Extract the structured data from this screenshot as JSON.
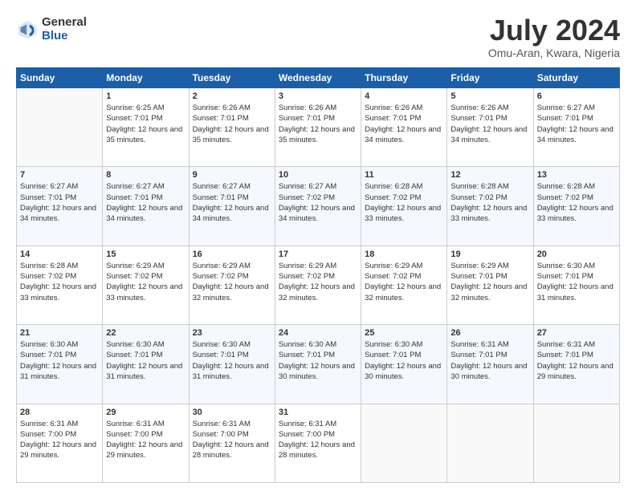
{
  "header": {
    "logo": {
      "general": "General",
      "blue": "Blue"
    },
    "title": "July 2024",
    "location": "Omu-Aran, Kwara, Nigeria"
  },
  "weekdays": [
    "Sunday",
    "Monday",
    "Tuesday",
    "Wednesday",
    "Thursday",
    "Friday",
    "Saturday"
  ],
  "weeks": [
    [
      {
        "day": "",
        "info": ""
      },
      {
        "day": "1",
        "sunrise": "6:25 AM",
        "sunset": "7:01 PM",
        "daylight": "12 hours and 35 minutes."
      },
      {
        "day": "2",
        "sunrise": "6:26 AM",
        "sunset": "7:01 PM",
        "daylight": "12 hours and 35 minutes."
      },
      {
        "day": "3",
        "sunrise": "6:26 AM",
        "sunset": "7:01 PM",
        "daylight": "12 hours and 35 minutes."
      },
      {
        "day": "4",
        "sunrise": "6:26 AM",
        "sunset": "7:01 PM",
        "daylight": "12 hours and 34 minutes."
      },
      {
        "day": "5",
        "sunrise": "6:26 AM",
        "sunset": "7:01 PM",
        "daylight": "12 hours and 34 minutes."
      },
      {
        "day": "6",
        "sunrise": "6:27 AM",
        "sunset": "7:01 PM",
        "daylight": "12 hours and 34 minutes."
      }
    ],
    [
      {
        "day": "7",
        "sunrise": "6:27 AM",
        "sunset": "7:01 PM",
        "daylight": "12 hours and 34 minutes."
      },
      {
        "day": "8",
        "sunrise": "6:27 AM",
        "sunset": "7:01 PM",
        "daylight": "12 hours and 34 minutes."
      },
      {
        "day": "9",
        "sunrise": "6:27 AM",
        "sunset": "7:01 PM",
        "daylight": "12 hours and 34 minutes."
      },
      {
        "day": "10",
        "sunrise": "6:27 AM",
        "sunset": "7:02 PM",
        "daylight": "12 hours and 34 minutes."
      },
      {
        "day": "11",
        "sunrise": "6:28 AM",
        "sunset": "7:02 PM",
        "daylight": "12 hours and 33 minutes."
      },
      {
        "day": "12",
        "sunrise": "6:28 AM",
        "sunset": "7:02 PM",
        "daylight": "12 hours and 33 minutes."
      },
      {
        "day": "13",
        "sunrise": "6:28 AM",
        "sunset": "7:02 PM",
        "daylight": "12 hours and 33 minutes."
      }
    ],
    [
      {
        "day": "14",
        "sunrise": "6:28 AM",
        "sunset": "7:02 PM",
        "daylight": "12 hours and 33 minutes."
      },
      {
        "day": "15",
        "sunrise": "6:29 AM",
        "sunset": "7:02 PM",
        "daylight": "12 hours and 33 minutes."
      },
      {
        "day": "16",
        "sunrise": "6:29 AM",
        "sunset": "7:02 PM",
        "daylight": "12 hours and 32 minutes."
      },
      {
        "day": "17",
        "sunrise": "6:29 AM",
        "sunset": "7:02 PM",
        "daylight": "12 hours and 32 minutes."
      },
      {
        "day": "18",
        "sunrise": "6:29 AM",
        "sunset": "7:02 PM",
        "daylight": "12 hours and 32 minutes."
      },
      {
        "day": "19",
        "sunrise": "6:29 AM",
        "sunset": "7:01 PM",
        "daylight": "12 hours and 32 minutes."
      },
      {
        "day": "20",
        "sunrise": "6:30 AM",
        "sunset": "7:01 PM",
        "daylight": "12 hours and 31 minutes."
      }
    ],
    [
      {
        "day": "21",
        "sunrise": "6:30 AM",
        "sunset": "7:01 PM",
        "daylight": "12 hours and 31 minutes."
      },
      {
        "day": "22",
        "sunrise": "6:30 AM",
        "sunset": "7:01 PM",
        "daylight": "12 hours and 31 minutes."
      },
      {
        "day": "23",
        "sunrise": "6:30 AM",
        "sunset": "7:01 PM",
        "daylight": "12 hours and 31 minutes."
      },
      {
        "day": "24",
        "sunrise": "6:30 AM",
        "sunset": "7:01 PM",
        "daylight": "12 hours and 30 minutes."
      },
      {
        "day": "25",
        "sunrise": "6:30 AM",
        "sunset": "7:01 PM",
        "daylight": "12 hours and 30 minutes."
      },
      {
        "day": "26",
        "sunrise": "6:31 AM",
        "sunset": "7:01 PM",
        "daylight": "12 hours and 30 minutes."
      },
      {
        "day": "27",
        "sunrise": "6:31 AM",
        "sunset": "7:01 PM",
        "daylight": "12 hours and 29 minutes."
      }
    ],
    [
      {
        "day": "28",
        "sunrise": "6:31 AM",
        "sunset": "7:00 PM",
        "daylight": "12 hours and 29 minutes."
      },
      {
        "day": "29",
        "sunrise": "6:31 AM",
        "sunset": "7:00 PM",
        "daylight": "12 hours and 29 minutes."
      },
      {
        "day": "30",
        "sunrise": "6:31 AM",
        "sunset": "7:00 PM",
        "daylight": "12 hours and 28 minutes."
      },
      {
        "day": "31",
        "sunrise": "6:31 AM",
        "sunset": "7:00 PM",
        "daylight": "12 hours and 28 minutes."
      },
      {
        "day": "",
        "info": ""
      },
      {
        "day": "",
        "info": ""
      },
      {
        "day": "",
        "info": ""
      }
    ]
  ]
}
